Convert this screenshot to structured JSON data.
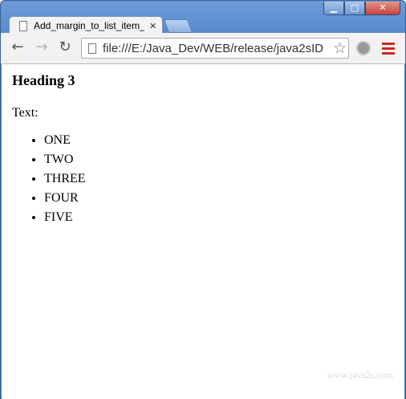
{
  "window": {
    "caption": {
      "minimize": "▁",
      "maximize": "□",
      "close": "✕"
    }
  },
  "tab": {
    "title": "Add_margin_to_list_item_",
    "close": "✕"
  },
  "toolbar": {
    "back": "←",
    "forward": "→",
    "reload": "↻",
    "url": "file:///E:/Java_Dev/WEB/release/java2sID",
    "star": "☆"
  },
  "page": {
    "heading": "Heading 3",
    "text_label": "Text:",
    "list_items": [
      "ONE",
      "TWO",
      "THREE",
      "FOUR",
      "FIVE"
    ],
    "watermark": "www.java2s.com"
  },
  "colors": {
    "frame": "#4f84c8",
    "menu_icon": "#cc2a20"
  }
}
